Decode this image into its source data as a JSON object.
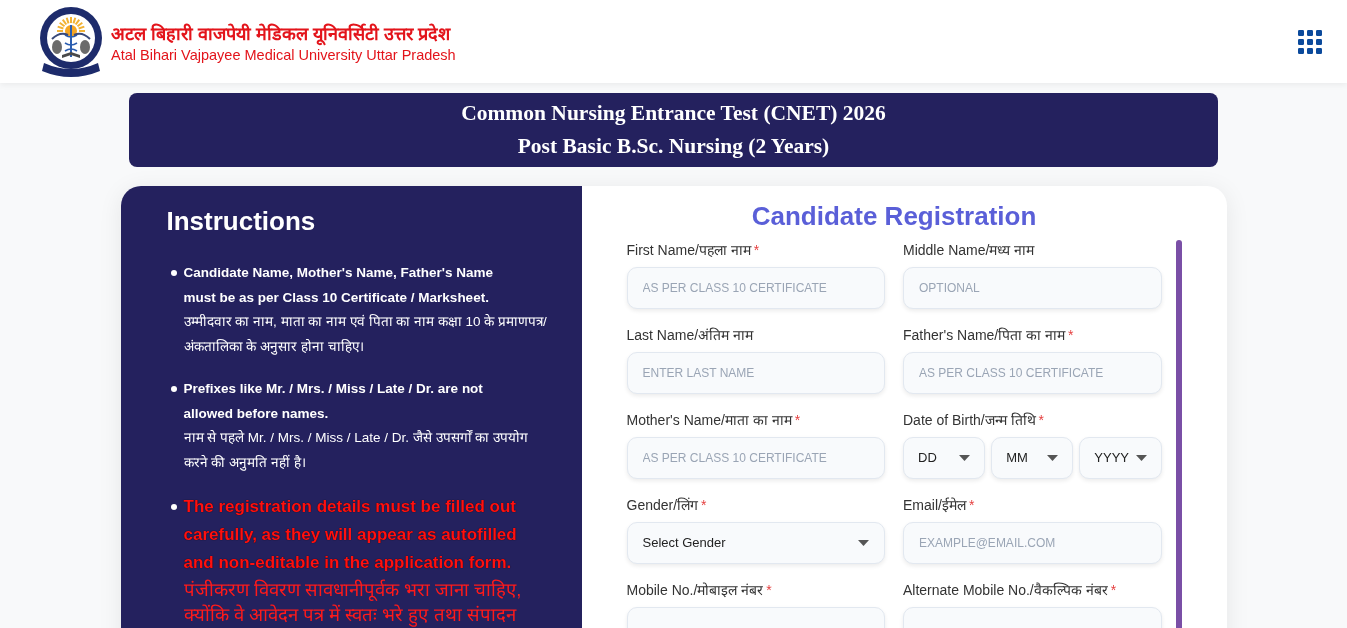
{
  "header": {
    "title_hi": "अटल बिहारी वाजपेयी मेडिकल यूनिवर्सिटी उत्तर प्रदेश",
    "title_en": "Atal Bihari Vajpayee Medical University Uttar Pradesh"
  },
  "banner": {
    "lines": [
      "Common Nursing Entrance Test (CNET) 2026",
      "Post Basic B.Sc. Nursing (2 Years)"
    ]
  },
  "instructions": {
    "title": "Instructions",
    "items": [
      {
        "kind": "normal",
        "en": "Candidate Name, Mother's Name, Father's Name must be as per Class 10 Certificate / Marksheet.",
        "hi": "उम्मीदवार का नाम, माता का नाम एवं पिता का नाम कक्षा 10 के प्रमाणपत्र/ अंकतालिका के अनुसार होना चाहिए।"
      },
      {
        "kind": "normal",
        "en": "Prefixes like Mr. / Mrs. / Miss / Late / Dr. are not allowed before names.",
        "hi": "नाम से पहले Mr. / Mrs. / Miss / Late / Dr. जैसे उपसर्गों का उपयोग करने की अनुमति नहीं है।"
      },
      {
        "kind": "warning",
        "en": "The registration details must be filled out carefully, as they will appear as autofilled and non-editable in the application form.",
        "hi": "पंजीकरण विवरण सावधानीपूर्वक भरा जाना चाहिए, क्योंकि वे आवेदन पत्र में स्वतः भरे हुए तथा संपादन"
      }
    ]
  },
  "registration": {
    "title": "Candidate Registration",
    "fields": [
      {
        "kind": "input",
        "label": "First Name/पहला नाम",
        "required_mark": "*",
        "placeholder": "AS PER CLASS 10 CERTIFICATE"
      },
      {
        "kind": "input",
        "label": "Middle Name/मध्य नाम",
        "placeholder": "OPTIONAL"
      },
      {
        "kind": "input",
        "label": "Last Name/अंतिम नाम",
        "placeholder": "ENTER LAST NAME"
      },
      {
        "kind": "input",
        "label": "Father's Name/पिता का नाम",
        "required_mark": "*",
        "placeholder": "AS PER CLASS 10 CERTIFICATE"
      },
      {
        "kind": "input",
        "label": "Mother's Name/माता का नाम",
        "required_mark": "*",
        "placeholder": "AS PER CLASS 10 CERTIFICATE"
      },
      {
        "kind": "date",
        "label": "Date of Birth/जन्म तिथि",
        "required_mark": "*",
        "parts": [
          "DD",
          "MM",
          "YYYY"
        ]
      },
      {
        "kind": "select",
        "label": "Gender/लिंग",
        "required_mark": "*",
        "value": "Select Gender"
      },
      {
        "kind": "input",
        "label": "Email/ईमेल",
        "required_mark": "*",
        "placeholder": "EXAMPLE@EMAIL.COM"
      },
      {
        "kind": "input",
        "label": "Mobile No./मोबाइल नंबर",
        "required_mark": "*"
      },
      {
        "kind": "input",
        "label": "Alternate Mobile No./वैकल्पिक नंबर",
        "required_mark": "*"
      }
    ]
  }
}
